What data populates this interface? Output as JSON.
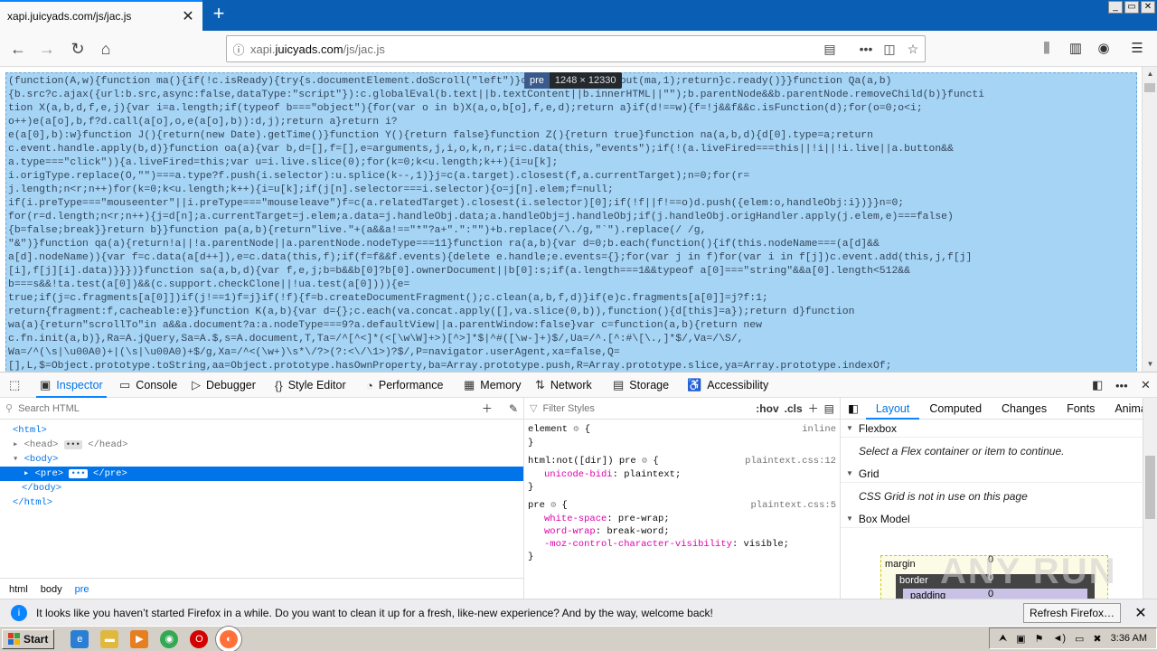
{
  "tab": {
    "title": "xapi.juicyads.com/js/jac.js",
    "close": "✕",
    "new_tab": "+"
  },
  "window_controls": [
    "_",
    "▭",
    "✕"
  ],
  "urlbar": {
    "prefix": "xapi.",
    "domain": "juicyads.com",
    "path": "/js/jac.js"
  },
  "tooltip": {
    "tag": "pre",
    "size": "1248 × 12330"
  },
  "page_code": [
    "(function(A,w){function ma(){if(!c.isReady){try{s.documentElement.doScroll(\"left\")}catch(a){setTimeout(ma,1);return}c.ready()}}function Qa(a,b)",
    "{b.src?c.ajax({url:b.src,async:false,dataType:\"script\"}):c.globalEval(b.text||b.textContent||b.innerHTML||\"\");b.parentNode&&b.parentNode.removeChild(b)}functi",
    "tion X(a,b,d,f,e,j){var i=a.length;if(typeof b===\"object\"){for(var o in b)X(a,o,b[o],f,e,d);return a}if(d!==w){f=!j&&f&&c.isFunction(d);for(o=0;o<i;",
    "o++)e(a[o],b,f?d.call(a[o],o,e(a[o],b)):d,j);return a}return i?",
    "e(a[0],b):w}function J(){return(new Date).getTime()}function Y(){return false}function Z(){return true}function na(a,b,d){d[0].type=a;return",
    "c.event.handle.apply(b,d)}function oa(a){var b,d=[],f=[],e=arguments,j,i,o,k,n,r;i=c.data(this,\"events\");if(!(a.liveFired===this||!i||!i.live||a.button&&",
    "a.type===\"click\")){a.liveFired=this;var u=i.live.slice(0);for(k=0;k<u.length;k++){i=u[k];",
    "i.origType.replace(O,\"\")===a.type?f.push(i.selector):u.splice(k--,1)}j=c(a.target).closest(f,a.currentTarget);n=0;for(r=",
    "j.length;n<r;n++)for(k=0;k<u.length;k++){i=u[k];if(j[n].selector===i.selector){o=j[n].elem;f=null;",
    "if(i.preType===\"mouseenter\"||i.preType===\"mouseleave\")f=c(a.relatedTarget).closest(i.selector)[0];if(!f||f!==o)d.push({elem:o,handleObj:i})}}n=0;",
    "for(r=d.length;n<r;n++){j=d[n];a.currentTarget=j.elem;a.data=j.handleObj.data;a.handleObj=j.handleObj;if(j.handleObj.origHandler.apply(j.elem,e)===false)",
    "{b=false;break}}return b}}function pa(a,b){return\"live.\"+(a&&a!==\"*\"?a+\".\":\"\")+b.replace(/\\./g,\"`\").replace(/ /g,",
    "\"&\")}function qa(a){return!a||!a.parentNode||a.parentNode.nodeType===11}function ra(a,b){var d=0;b.each(function(){if(this.nodeName===(a[d]&&",
    "a[d].nodeName)){var f=c.data(a[d++]),e=c.data(this,f);if(f=f&&f.events){delete e.handle;e.events={};for(var j in f)for(var i in f[j])c.event.add(this,j,f[j]",
    "[i],f[j][i].data)}}})}function sa(a,b,d){var f,e,j;b=b&&b[0]?b[0].ownerDocument||b[0]:s;if(a.length===1&&typeof a[0]===\"string\"&&a[0].length<512&&",
    "b===s&&!ta.test(a[0])&&(c.support.checkClone||!ua.test(a[0]))){e=",
    "true;if(j=c.fragments[a[0]])if(j!==1)f=j}if(!f){f=b.createDocumentFragment();c.clean(a,b,f,d)}if(e)c.fragments[a[0]]=j?f:1;",
    "return{fragment:f,cacheable:e}}function K(a,b){var d={};c.each(va.concat.apply([],va.slice(0,b)),function(){d[this]=a});return d}function",
    "wa(a){return\"scrollTo\"in a&&a.document?a:a.nodeType===9?a.defaultView||a.parentWindow:false}var c=function(a,b){return new",
    "c.fn.init(a,b)},Ra=A.jQuery,Sa=A.$,s=A.document,T,Ta=/^[^<]*(<[\\w\\W]+>)[^>]*$|^#([\\w-]+)$/,Ua=/^.[^:#\\[\\.,]*$/,Va=/\\S/,",
    "Wa=/^(\\s|\\u00A0)+|(\\s|\\u00A0)+$/g,Xa=/^<(\\w+)\\s*\\/?>(?:<\\/\\1>)?$/,P=navigator.userAgent,xa=false,Q=",
    "[],L,$=Object.prototype.toString,aa=Object.prototype.hasOwnProperty,ba=Array.prototype.push,R=Array.prototype.slice,ya=Array.prototype.indexOf;"
  ],
  "devtools": {
    "tabs": [
      {
        "label": "Inspector",
        "icon": "inspector-icon"
      },
      {
        "label": "Console",
        "icon": "console-icon"
      },
      {
        "label": "Debugger",
        "icon": "debugger-icon"
      },
      {
        "label": "Style Editor",
        "icon": "style-editor-icon"
      },
      {
        "label": "Performance",
        "icon": "performance-icon"
      },
      {
        "label": "Memory",
        "icon": "memory-icon"
      },
      {
        "label": "Network",
        "icon": "network-icon"
      },
      {
        "label": "Storage",
        "icon": "storage-icon"
      },
      {
        "label": "Accessibility",
        "icon": "accessibility-icon"
      }
    ],
    "search_placeholder": "Search HTML",
    "filter_placeholder": "Filter Styles",
    "hov": ":hov",
    "cls": ".cls",
    "markup": {
      "html_open": "<html>",
      "head": "<head>",
      "head_close": "</head>",
      "body_open": "<body>",
      "pre_open": "<pre>",
      "pre_close": "</pre>",
      "body_close": "</body>",
      "html_close": "</html>"
    },
    "breadcrumbs": [
      "html",
      "body",
      "pre"
    ],
    "rules": [
      {
        "selector": "element",
        "source": "inline",
        "decls": []
      },
      {
        "selector": "html:not([dir]) pre",
        "source": "plaintext.css:12",
        "decls": [
          {
            "prop": "unicode-bidi",
            "val": "plaintext"
          }
        ]
      },
      {
        "selector": "pre",
        "source": "plaintext.css:5",
        "decls": [
          {
            "prop": "white-space",
            "val": "pre-wrap"
          },
          {
            "prop": "word-wrap",
            "val": "break-word"
          },
          {
            "prop": "-moz-control-character-visibility",
            "val": "visible"
          }
        ]
      }
    ],
    "layout_tabs": [
      "Layout",
      "Computed",
      "Changes",
      "Fonts",
      "Animat"
    ],
    "flexbox_title": "Flexbox",
    "flexbox_msg": "Select a Flex container or item to continue.",
    "grid_title": "Grid",
    "grid_msg": "CSS Grid is not in use on this page",
    "boxmodel_title": "Box Model",
    "boxmodel": {
      "margin": "margin",
      "border": "border",
      "padding": "padding",
      "margin_val": "0",
      "border_val": "0",
      "padding_val": "0"
    }
  },
  "notification": {
    "message": "It looks like you haven’t started Firefox in a while. Do you want to clean it up for a fresh, like-new experience? And by the way, welcome back!",
    "button": "Refresh Firefox…"
  },
  "taskbar": {
    "start": "Start",
    "clock": "3:36 AM"
  },
  "watermark": "ANY RUN"
}
